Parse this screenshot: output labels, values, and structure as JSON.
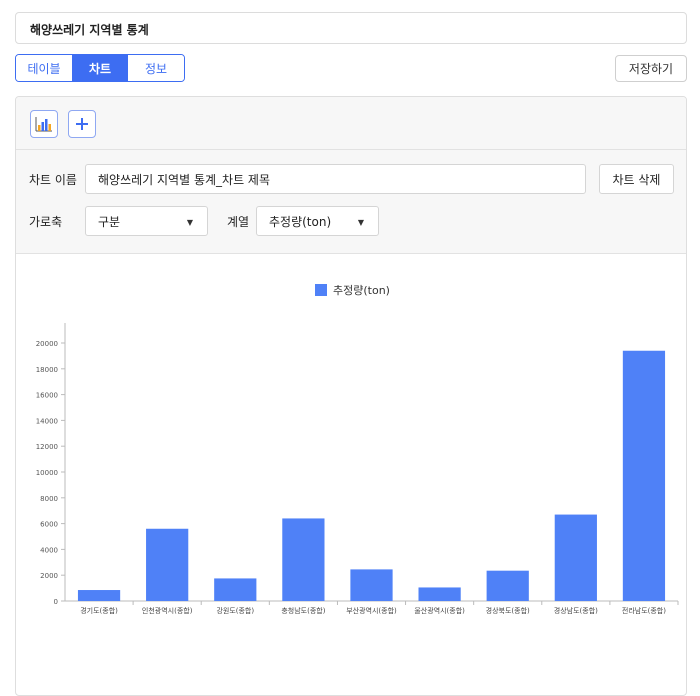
{
  "title": "해양쓰레기 지역별 통계",
  "tabs": [
    {
      "label": "테이블",
      "active": false
    },
    {
      "label": "차트",
      "active": true
    },
    {
      "label": "정보",
      "active": false
    }
  ],
  "save_label": "저장하기",
  "toolbar": {
    "chart_icon": "bar-chart-icon",
    "add_icon": "plus-icon"
  },
  "settings": {
    "name_label": "차트 이름",
    "name_value": "해양쓰레기 지역별 통계_차트 제목",
    "delete_label": "차트 삭제",
    "xaxis_label": "가로축",
    "xaxis_value": "구분",
    "series_label": "계열",
    "series_value": "추정량(ton)"
  },
  "colors": {
    "accent": "#3d6df2",
    "bar": "#4f81f7"
  },
  "chart_data": {
    "type": "bar",
    "categories": [
      "경기도(종합)",
      "인천광역시(종합)",
      "강원도(종합)",
      "충청남도(종합)",
      "부산광역시(종합)",
      "울산광역시(종합)",
      "경상북도(종합)",
      "경상남도(종합)",
      "전라남도(종합)"
    ],
    "series": [
      {
        "name": "추정량(ton)",
        "values": [
          850,
          5600,
          1750,
          6400,
          2450,
          1050,
          2350,
          6700,
          19400
        ]
      }
    ],
    "yticks": [
      0,
      2000,
      4000,
      6000,
      8000,
      10000,
      12000,
      14000,
      16000,
      18000,
      20000
    ],
    "ylim": [
      0,
      20000
    ],
    "legend": "top-center"
  }
}
